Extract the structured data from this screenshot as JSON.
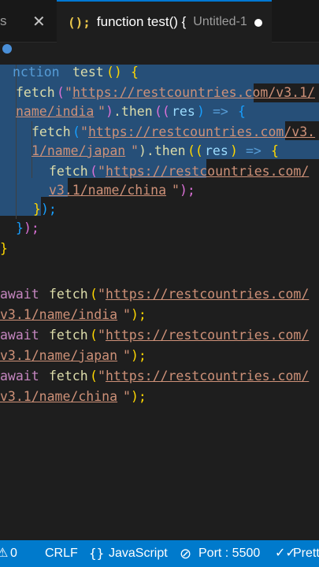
{
  "tabs": {
    "inactive_label": "s",
    "active_icon": "();",
    "active_title": "function test() {",
    "active_description": "Untitled-1"
  },
  "code": {
    "l1": {
      "a": "nction",
      "b": "test",
      "c": "()",
      "d": "{"
    },
    "l2": {
      "fetch": "fetch",
      "q1": "\"",
      "url": "https://restcountries.com/v3.1/"
    },
    "l3": {
      "url": "name/india",
      "q2": "\"",
      "then": ".then",
      "p": "((",
      "res": "res",
      "p2": ")",
      "arrow": "=>",
      "b": "{"
    },
    "l4": {
      "fetch": "fetch",
      "q1": "\"",
      "url": "https://restcountries.com/v3."
    },
    "l5": {
      "url": "1/name/japan",
      "q2": "\"",
      "then": ").then",
      "p": "((",
      "res": "res",
      "p2": ")",
      "arrow": "=>",
      "b": "{"
    },
    "l6": {
      "fetch": "fetch",
      "q1": "\"",
      "url": "https://restcountries.com/"
    },
    "l7": {
      "url": "v3.1/name/china",
      "q2": "\"",
      "end": ");"
    },
    "l8": {
      "b": "}",
      "end": ");"
    },
    "l9": {
      "b": "}",
      "end": ");"
    },
    "l10": {
      "b": "}"
    },
    "l12": {
      "kw": "await",
      "fetch": "fetch",
      "p": "(",
      "q1": "\"",
      "url": "https://restcountries.com/"
    },
    "l13": {
      "url": "v3.1/name/india",
      "q2": "\"",
      "end": ");"
    },
    "l14": {
      "kw": "await",
      "fetch": "fetch",
      "p": "(",
      "q1": "\"",
      "url": "https://restcountries.com/"
    },
    "l15": {
      "url": "v3.1/name/japan",
      "q2": "\"",
      "end": ");"
    },
    "l16": {
      "kw": "await",
      "fetch": "fetch",
      "p": "(",
      "q1": "\"",
      "url": "https://restcountries.com/"
    },
    "l17": {
      "url": "v3.1/name/china",
      "q2": "\"",
      "end": ");"
    }
  },
  "status": {
    "errors": "0",
    "eol": "CRLF",
    "lang_icon": "{}",
    "language": "JavaScript",
    "port": "Port : 5500",
    "prettier": "Prett"
  },
  "colors": {
    "accent": "#007acc",
    "selection": "#264f78",
    "editor_bg": "#1e1e1e"
  }
}
